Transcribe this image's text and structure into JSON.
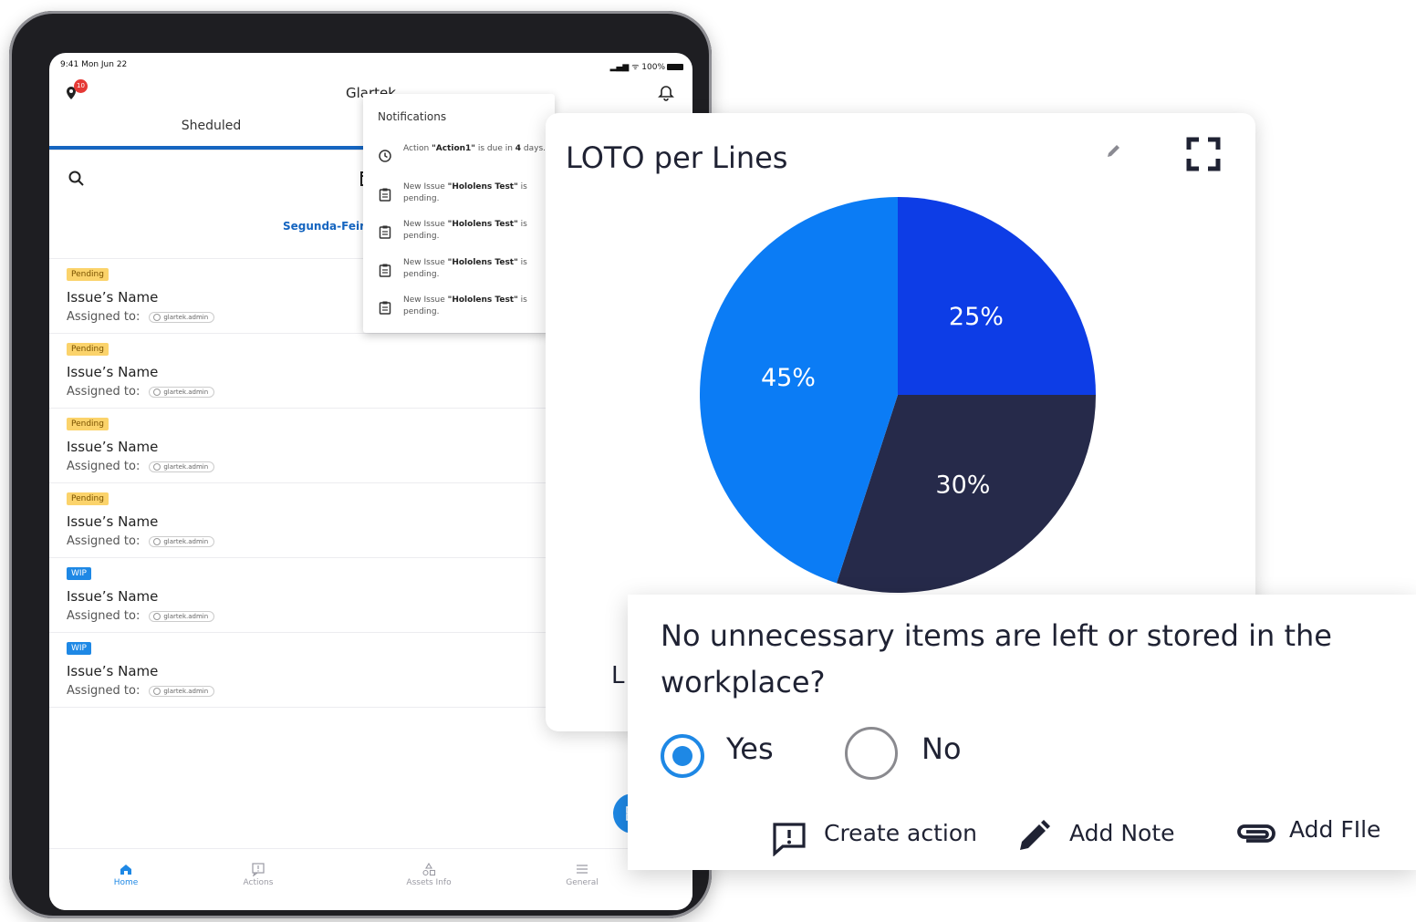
{
  "status_bar": {
    "time": "9:41  Mon Jun 22",
    "battery": "100%"
  },
  "app": {
    "title": "Glartek",
    "location_badge": "10"
  },
  "tabs": {
    "scheduled": "Sheduled"
  },
  "date_label": "Segunda-Feira, …",
  "issues": [
    {
      "status": "Pending",
      "name": "Issue’s Name",
      "assigned_label": "Assigned to:",
      "assignee": "glartek.admin"
    },
    {
      "status": "Pending",
      "name": "Issue’s Name",
      "assigned_label": "Assigned to:",
      "assignee": "glartek.admin"
    },
    {
      "status": "Pending",
      "name": "Issue’s Name",
      "assigned_label": "Assigned to:",
      "assignee": "glartek.admin"
    },
    {
      "status": "Pending",
      "name": "Issue’s Name",
      "assigned_label": "Assigned to:",
      "assignee": "glartek.admin"
    },
    {
      "status": "WIP",
      "name": "Issue’s Name",
      "assigned_label": "Assigned to:",
      "assignee": "glartek.admin"
    },
    {
      "status": "WIP",
      "name": "Issue’s Name",
      "assigned_label": "Assigned to:",
      "assignee": "glartek.admin"
    }
  ],
  "notifications": {
    "title": "Notifications",
    "items": [
      {
        "icon": "clock-icon",
        "prefix": "Action ",
        "bold": "\"Action1\"",
        "middle": " is due in ",
        "bold2": "4",
        "suffix": " days."
      },
      {
        "icon": "clipboard-icon",
        "prefix": "New Issue ",
        "bold": "\"Hololens Test\"",
        "middle": " is pending.",
        "bold2": "",
        "suffix": ""
      },
      {
        "icon": "clipboard-icon",
        "prefix": "New Issue ",
        "bold": "\"Hololens Test\"",
        "middle": " is pending.",
        "bold2": "",
        "suffix": ""
      },
      {
        "icon": "clipboard-icon",
        "prefix": "New Issue ",
        "bold": "\"Hololens Test\"",
        "middle": " is pending.",
        "bold2": "",
        "suffix": ""
      },
      {
        "icon": "clipboard-icon",
        "prefix": "New Issue ",
        "bold": "\"Hololens Test\"",
        "middle": " is pending.",
        "bold2": "",
        "suffix": ""
      }
    ]
  },
  "bottom_nav": [
    {
      "label": "Home",
      "icon": "home-icon",
      "active": true
    },
    {
      "label": "Actions",
      "icon": "actions-icon",
      "active": false
    },
    {
      "label": "Assets Info",
      "icon": "assets-icon",
      "active": false
    },
    {
      "label": "General",
      "icon": "list-icon",
      "active": false
    }
  ],
  "chart_card": {
    "partial_label": "L"
  },
  "chart_data": {
    "type": "pie",
    "title": "LOTO per Lines",
    "slices": [
      {
        "label": "25%",
        "value": 25,
        "color": "#0d3de6"
      },
      {
        "label": "30%",
        "value": 30,
        "color": "#262a4a"
      },
      {
        "label": "45%",
        "value": 45,
        "color": "#0b7cf5"
      }
    ]
  },
  "question": {
    "text": "No unnecessary items are left or stored in the workplace?",
    "options": [
      "Yes",
      "No"
    ],
    "selected": "Yes",
    "actions": {
      "create_action": "Create action",
      "add_note": "Add Note",
      "add_file": "Add FIle"
    }
  },
  "colors": {
    "accent": "#1e88e5",
    "pending": "#fbd36b",
    "dark_text": "#1f2233"
  }
}
